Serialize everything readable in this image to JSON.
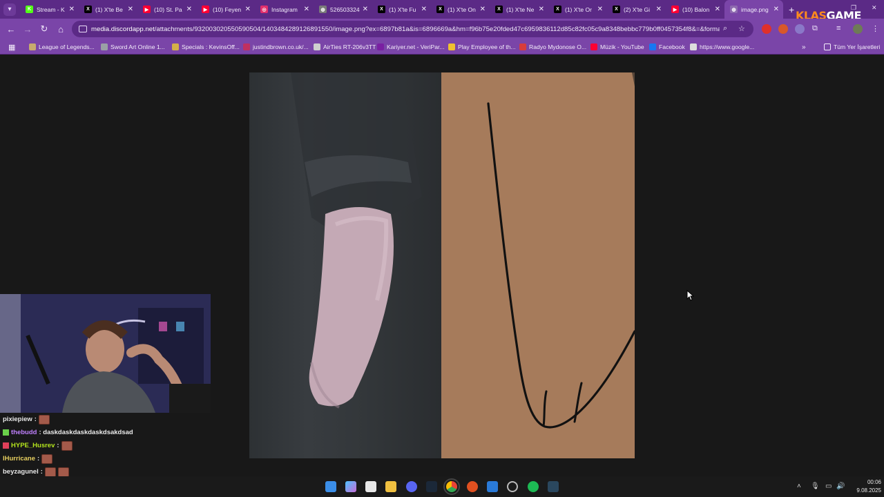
{
  "browser": {
    "tabs": [
      {
        "title": "Stream - K",
        "favicon": "kick-icon",
        "color": "#53fc18",
        "glyph": "K"
      },
      {
        "title": "(1) X'te Be",
        "favicon": "x-icon",
        "color": "#000000",
        "glyph": "X"
      },
      {
        "title": "(10) St. Pa",
        "favicon": "youtube-icon",
        "color": "#ff0033",
        "glyph": "▶"
      },
      {
        "title": "(10) Feyen",
        "favicon": "youtube-icon",
        "color": "#ff0033",
        "glyph": "▶"
      },
      {
        "title": "Instagram",
        "favicon": "instagram-icon",
        "color": "#e1306c",
        "glyph": "◎"
      },
      {
        "title": "526503324",
        "favicon": "globe-icon",
        "color": "#7a7a7a",
        "glyph": "◍"
      },
      {
        "title": "(1) X'te Fu",
        "favicon": "x-icon",
        "color": "#000000",
        "glyph": "X"
      },
      {
        "title": "(1) X'te On",
        "favicon": "x-icon",
        "color": "#000000",
        "glyph": "X"
      },
      {
        "title": "(1) X'te Ne",
        "favicon": "x-icon",
        "color": "#000000",
        "glyph": "X"
      },
      {
        "title": "(1) X'te Or",
        "favicon": "x-icon",
        "color": "#000000",
        "glyph": "X"
      },
      {
        "title": "(2) X'te Gi",
        "favicon": "x-icon",
        "color": "#000000",
        "glyph": "X"
      },
      {
        "title": "(10) Balon",
        "favicon": "youtube-icon",
        "color": "#ff0033",
        "glyph": "▶"
      },
      {
        "title": "image.png",
        "favicon": "globe-icon",
        "color": "#8e6ab0",
        "glyph": "◍",
        "active": true
      }
    ],
    "brand": {
      "prefix": "KLAS",
      "suffix": "GAME"
    },
    "url_host": "media.discordapp.net",
    "url_path": "/attachments/932003020550590504/1403484289126891550/image.png?ex=6897b81a&is=6896669a&hm=f96b75e20fded47c6959836112d85c82fc05c9a8348bebbc779b0ff0457354f8&=&format=w...",
    "bookmarks": [
      {
        "label": "League of Legends...",
        "color": "#c8aa6e"
      },
      {
        "label": "Sword Art Online 1...",
        "color": "#9aa0a6"
      },
      {
        "label": "Specials : KevinsOff...",
        "color": "#d4b048"
      },
      {
        "label": "justindbrown.co.uk/...",
        "color": "#c03060"
      },
      {
        "label": "AirTies RT-206v3TT",
        "color": "#cfcfcf"
      },
      {
        "label": "Kariyer.net - VeriPar...",
        "color": "#7a1fa2"
      },
      {
        "label": "Play Employee of th...",
        "color": "#f0c030"
      },
      {
        "label": "Radyo Mydonose O...",
        "color": "#d83c3c"
      },
      {
        "label": "Müzik - YouTube",
        "color": "#ff0033"
      },
      {
        "label": "Facebook",
        "color": "#1877f2"
      },
      {
        "label": "https://www.google...",
        "color": "#dddddd"
      }
    ],
    "bookmarks_folder": "Tüm Yer İşaretleri"
  },
  "chat": [
    {
      "user": "pixiepiew",
      "color": "#e8e8e8",
      "text": ":",
      "emotes": 1
    },
    {
      "user": "thebudd",
      "color": "#c080ff",
      "text": ": daskdaskdaskdaskdsakdsad",
      "emotes": 0,
      "badge": "#6ad04a"
    },
    {
      "user": "HYPE_Husrev",
      "color": "#b5e61d",
      "text": ":",
      "emotes": 1,
      "badge": "#e0405a"
    },
    {
      "user": "lHurricane",
      "color": "#e8d060",
      "text": ":",
      "emotes": 1
    },
    {
      "user": "beyzagunel",
      "color": "#e8e8e8",
      "text": ":",
      "emotes": 2
    }
  ],
  "clock": {
    "time": "00:06",
    "date": "9.08.2025"
  }
}
